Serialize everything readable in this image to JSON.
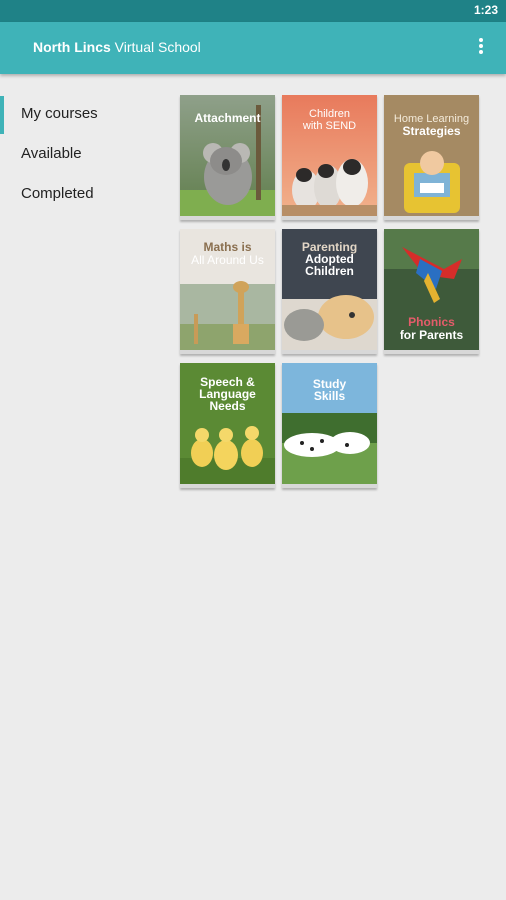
{
  "status": {
    "time": "1:23"
  },
  "appbar": {
    "title_bold": "North Lincs",
    "title_rest": " Virtual School"
  },
  "nav": [
    {
      "label": "My courses"
    },
    {
      "label": "Available"
    },
    {
      "label": "Completed"
    }
  ],
  "courses": [
    {
      "line1": "Attachment",
      "line2": ""
    },
    {
      "line1": "Children",
      "line2": "with SEND"
    },
    {
      "line1": "Home Learning",
      "line2": "Strategies"
    },
    {
      "line1": "Maths is",
      "line2": "All Around Us"
    },
    {
      "line1": "Parenting",
      "line2": "Adopted",
      "line3": "Children"
    },
    {
      "line1": "Phonics",
      "line2": "for Parents"
    },
    {
      "line1": "Speech &",
      "line2": "Language",
      "line3": "Needs"
    },
    {
      "line1": "Study",
      "line2": "Skills"
    }
  ]
}
